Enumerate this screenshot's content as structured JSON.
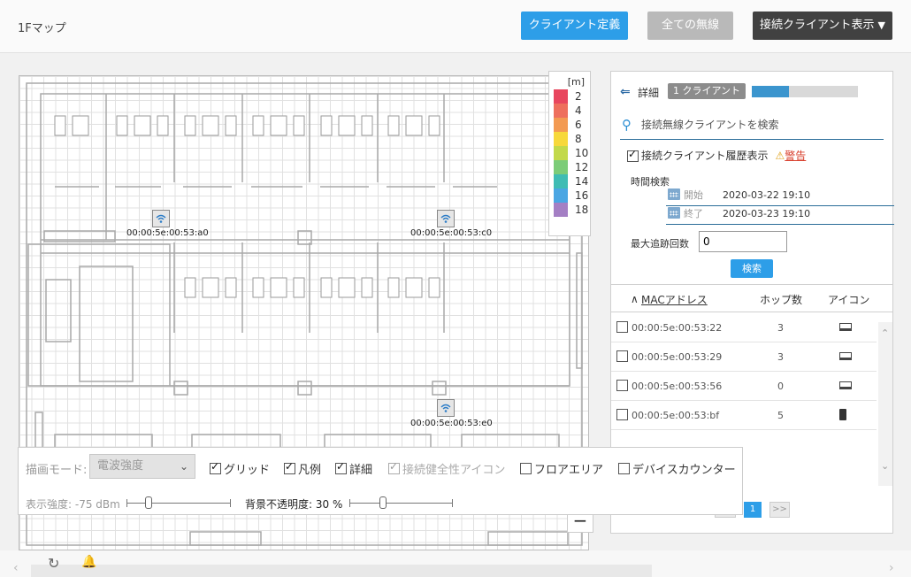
{
  "header": {
    "page_title": "1Fマップ",
    "client_definition_button": "クライアント定義",
    "all_wireless_button": "全ての無線",
    "connected_clients_button": "接続クライアント表示",
    "caret": "▼"
  },
  "colors": {
    "primary": "#2d9ee8",
    "disabled": "#b9b9b9",
    "dark": "#414141",
    "warning": "#d8402e"
  },
  "map": {
    "access_points": [
      {
        "label": "00:00:5e:00:53:a0",
        "icon": "wifi-icon"
      },
      {
        "label": "00:00:5e:00:53:c0",
        "icon": "wifi-icon"
      },
      {
        "label": "00:00:5e:00:53:e0",
        "icon": "wifi-icon"
      }
    ],
    "zoom_minus": "−"
  },
  "legend": {
    "unit": "[m]",
    "items": [
      {
        "value": "2",
        "color": "#e8465e"
      },
      {
        "value": "4",
        "color": "#ee6f5d"
      },
      {
        "value": "6",
        "color": "#f39a52"
      },
      {
        "value": "8",
        "color": "#f7d83a"
      },
      {
        "value": "10",
        "color": "#c2d94a"
      },
      {
        "value": "12",
        "color": "#7ccc78"
      },
      {
        "value": "14",
        "color": "#3fbcb4"
      },
      {
        "value": "16",
        "color": "#4aa6e3"
      },
      {
        "value": "18",
        "color": "#a47fc4"
      }
    ]
  },
  "details": {
    "back_icon": "⇐",
    "title": "詳細",
    "badge": "1 クライアント",
    "progress_fraction": 0.35,
    "search_placeholder": "接続無線クライアントを検索",
    "history_label": "接続クライアント履歴表示",
    "history_checked": true,
    "warning_icon": "⚠",
    "warning_link": "警告",
    "time_search_label": "時間検索",
    "start_label": "開始",
    "start_value": "2020-03-22 19:10",
    "end_label": "終了",
    "end_value": "2020-03-23 19:10",
    "max_trace_label": "最大追跡回数",
    "max_trace_value": "0",
    "search_button": "検索",
    "table": {
      "sort_icon": "∧",
      "headers": {
        "mac": "MACアドレス",
        "hops": "ホップ数",
        "icon": "アイコン"
      },
      "rows": [
        {
          "mac": "00:00:5e:00:53:22",
          "hops": "3",
          "device": "laptop"
        },
        {
          "mac": "00:00:5e:00:53:29",
          "hops": "3",
          "device": "laptop"
        },
        {
          "mac": "00:00:5e:00:53:56",
          "hops": "0",
          "device": "laptop"
        },
        {
          "mac": "00:00:5e:00:53:bf",
          "hops": "5",
          "device": "phone"
        }
      ]
    },
    "scroll_up": "⌃",
    "scroll_down": "⌄",
    "pager": {
      "prev": "<<",
      "current": "1",
      "next": ">>"
    }
  },
  "controls": {
    "mode_label": "描画モード:",
    "mode_value": "電波強度",
    "mode_chevron": "⌄",
    "options": [
      {
        "label": "グリッド",
        "checked": true,
        "disabled": false
      },
      {
        "label": "凡例",
        "checked": true,
        "disabled": false
      },
      {
        "label": "詳細",
        "checked": true,
        "disabled": false
      },
      {
        "label": "接続健全性アイコン",
        "checked": true,
        "disabled": true
      },
      {
        "label": "フロアエリア",
        "checked": false,
        "disabled": false
      },
      {
        "label": "デバイスカウンター",
        "checked": false,
        "disabled": false
      }
    ],
    "strength_label": "表示強度: -75 dBm",
    "opacity_label": "背景不透明度: 30 %",
    "opacity_percent": 30
  },
  "footer": {
    "left_arrow": "‹",
    "right_arrow": "›",
    "refresh_icon": "↻",
    "bell_icon": "🔔"
  }
}
